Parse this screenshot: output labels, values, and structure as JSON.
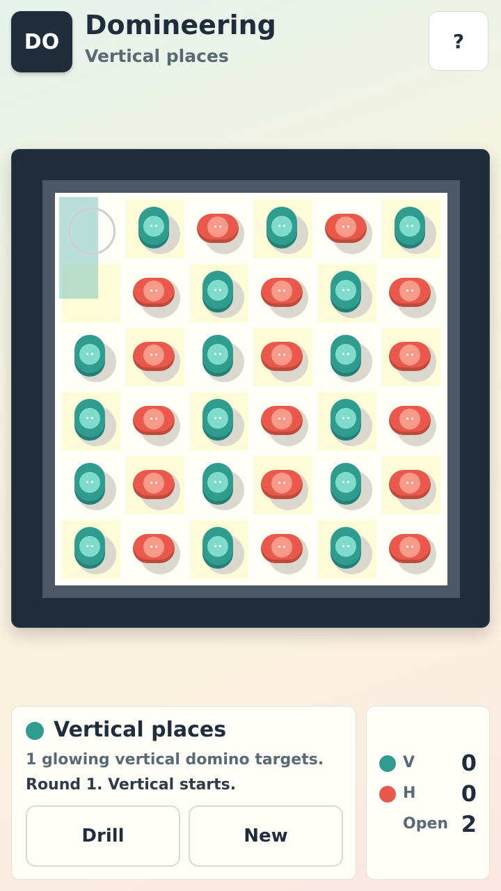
{
  "header": {
    "logo": "DO",
    "title": "Domineering",
    "subtitle": "Vertical places",
    "help_label": "?"
  },
  "colors": {
    "vertical": "#2f9c8f",
    "horizontal": "#e8594b",
    "board_frame": "#1f2d3d"
  },
  "board": {
    "rows": 6,
    "cols": 6,
    "cells": [
      [
        "empty",
        "v",
        "h",
        "v",
        "h",
        "v"
      ],
      [
        "empty",
        "h",
        "v",
        "h",
        "v",
        "h"
      ],
      [
        "v",
        "h",
        "v",
        "h",
        "v",
        "h"
      ],
      [
        "v",
        "h",
        "v",
        "h",
        "v",
        "h"
      ],
      [
        "v",
        "h",
        "v",
        "h",
        "v",
        "h"
      ],
      [
        "v",
        "h",
        "v",
        "h",
        "v",
        "h"
      ]
    ],
    "shaded": [
      [
        0,
        1,
        0,
        1,
        0,
        1
      ],
      [
        1,
        0,
        1,
        0,
        1,
        0
      ],
      [
        0,
        1,
        0,
        1,
        0,
        1
      ],
      [
        1,
        0,
        1,
        0,
        1,
        0
      ],
      [
        0,
        1,
        0,
        1,
        0,
        1
      ],
      [
        1,
        0,
        1,
        0,
        1,
        0
      ]
    ],
    "target_column": 0,
    "target_rows": [
      0,
      1
    ]
  },
  "info": {
    "title": "Vertical places",
    "line1": "1 glowing vertical domino targets.",
    "line2": "Round 1. Vertical starts.",
    "drill_label": "Drill",
    "new_label": "New"
  },
  "score": {
    "v_label": "V",
    "v_value": "0",
    "h_label": "H",
    "h_value": "0",
    "open_label": "Open",
    "open_value": "2"
  }
}
